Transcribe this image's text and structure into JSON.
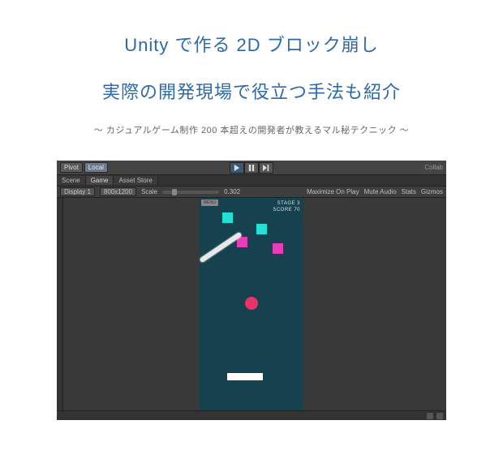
{
  "titles": {
    "line1": "Unity で作る 2D ブロック崩し",
    "line2": "実際の開発現場で役立つ手法も紹介",
    "subtitle": "〜 カジュアルゲーム制作 200 本超えの開発者が教えるマル秘テクニック 〜"
  },
  "editor": {
    "top": {
      "pivot": "Pivot",
      "local": "Local",
      "collab": "Collab"
    },
    "tabs": {
      "scene": "Scene",
      "game": "Game",
      "asset_store": "Asset Store"
    },
    "ctrl": {
      "display": "Display 1",
      "resolution": "800x1200",
      "scale_label": "Scale",
      "scale_value": "0.302",
      "maximize": "Maximize On Play",
      "mute": "Mute Audio",
      "stats": "Stats",
      "gizmos": "Gizmos"
    },
    "hud": {
      "stage": "STAGE 3",
      "score": "SCORE 70"
    },
    "menu_label": "MENU"
  },
  "colors": {
    "title": "#2d6aa9",
    "game_bg": "#16414f",
    "cyan": "#22e0d6",
    "magenta": "#e63eb8",
    "ball": "#e8326a"
  }
}
